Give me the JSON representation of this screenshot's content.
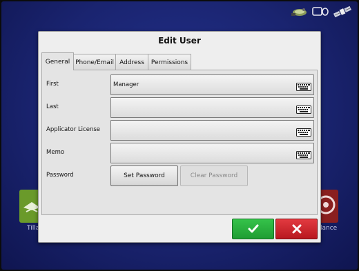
{
  "dialog": {
    "title": "Edit User",
    "tabs": [
      {
        "label": "General",
        "active": true
      },
      {
        "label": "Phone/Email",
        "active": false
      },
      {
        "label": "Address",
        "active": false
      },
      {
        "label": "Permissions",
        "active": false
      }
    ],
    "fields": {
      "first": {
        "label": "First",
        "value": "Manager"
      },
      "last": {
        "label": "Last",
        "value": ""
      },
      "applicator_license": {
        "label": "Applicator License",
        "value": ""
      },
      "memo": {
        "label": "Memo",
        "value": ""
      }
    },
    "password": {
      "label": "Password",
      "set_label": "Set Password",
      "clear_label": "Clear Password",
      "clear_enabled": false
    },
    "ok_icon": "checkmark-icon",
    "cancel_icon": "x-icon"
  },
  "background": {
    "tile_left_label": "Tilla",
    "tile_right_label": "lance"
  },
  "status_bar": {
    "icons": [
      "satellite-dish-icon",
      "display-icon",
      "gps-satellite-icon"
    ]
  },
  "colors": {
    "ok": "#2bb040",
    "cancel": "#d0262c",
    "screen_background": "#1a2470"
  }
}
